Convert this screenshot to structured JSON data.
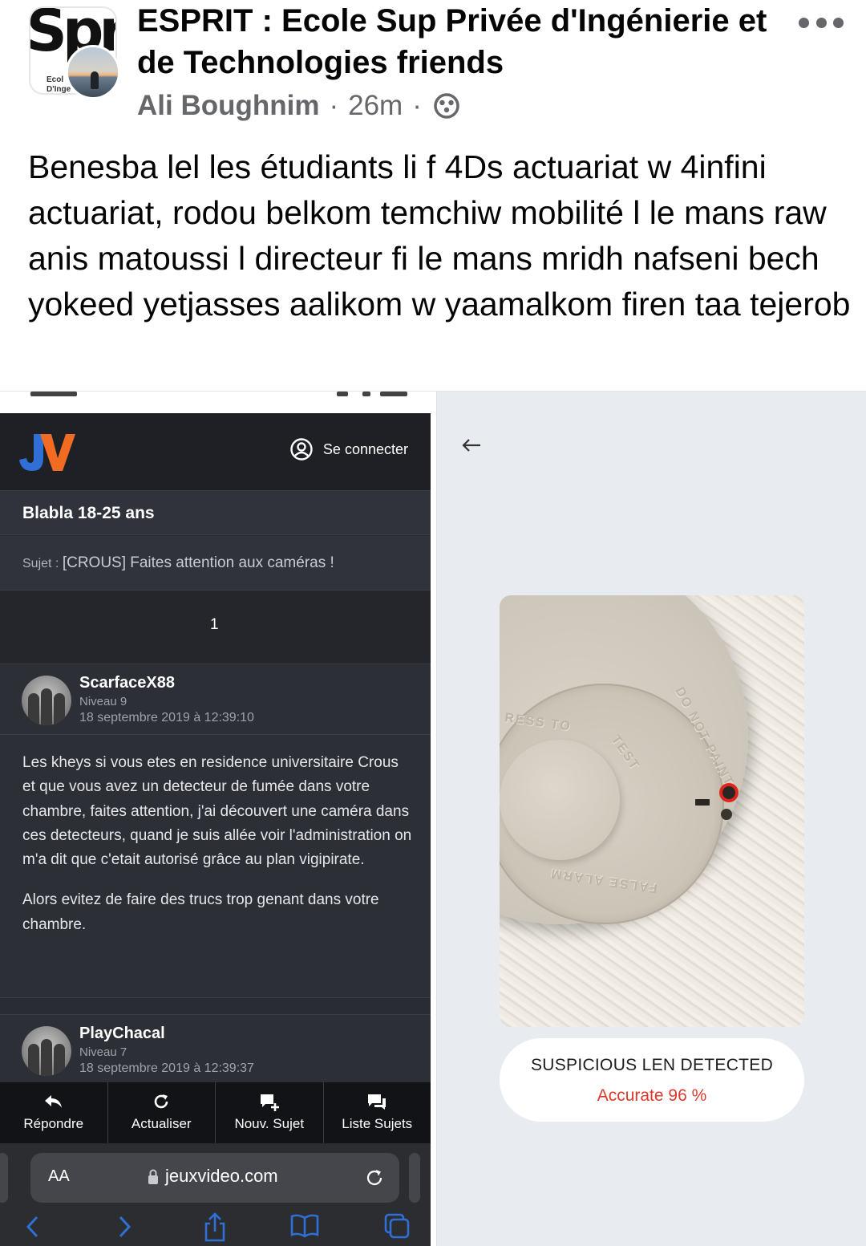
{
  "post": {
    "group_name": "ESPRIT : Ecole Sup Privée d'Ingénierie et de Technologies friends",
    "author": "Ali Boughnim",
    "time": "26m",
    "separator": "·",
    "text": "Benesba lel les étudiants li f 4Ds actuariat w 4infini actuariat, rodou belkom temchiw mobilité l le mans raw anis matoussi l directeur fi le mans mridh nafseni bech yokeed yetjasses aalikom w yaamalkom firen taa tejerob",
    "group_logo_text": "Spr",
    "group_logo_sub": "Ecol\nD'Inge"
  },
  "jv": {
    "login_label": "Se connecter",
    "forum_title": "Blabla 18-25 ans",
    "subject_prefix": "Sujet : ",
    "subject_title": "[CROUS] Faites attention aux caméras !",
    "page_number": "1",
    "messages": [
      {
        "pseudo": "ScarfaceX88",
        "level": "Niveau 9",
        "date": "18 septembre 2019 à 12:39:10",
        "paragraphs": [
          "Les kheys si vous etes en residence universitaire Crous et que vous avez un detecteur de fumée dans votre chambre, faites attention, j'ai découvert une caméra dans ces detecteurs, quand je suis allée voir l'administration on m'a dit que c'etait autorisé grâce au plan vigipirate.",
          "Alors evitez de faire des trucs trop genant dans votre chambre."
        ]
      },
      {
        "pseudo": "PlayChacal",
        "level": "Niveau 7",
        "date": "18 septembre 2019 à 12:39:37"
      }
    ],
    "toolbar": [
      "Répondre",
      "Actualiser",
      "Nouv. Sujet",
      "Liste Sujets"
    ],
    "address_aa": "AA",
    "address_domain": "jeuxvideo.com",
    "colors": {
      "logo_blue": "#2f6fd6",
      "logo_orange": "#f26b22"
    }
  },
  "detector": {
    "result_title": "SUSPICIOUS LEN DETECTED",
    "accuracy": "Accurate 96 %",
    "accuracy_color": "#d93a2b"
  }
}
